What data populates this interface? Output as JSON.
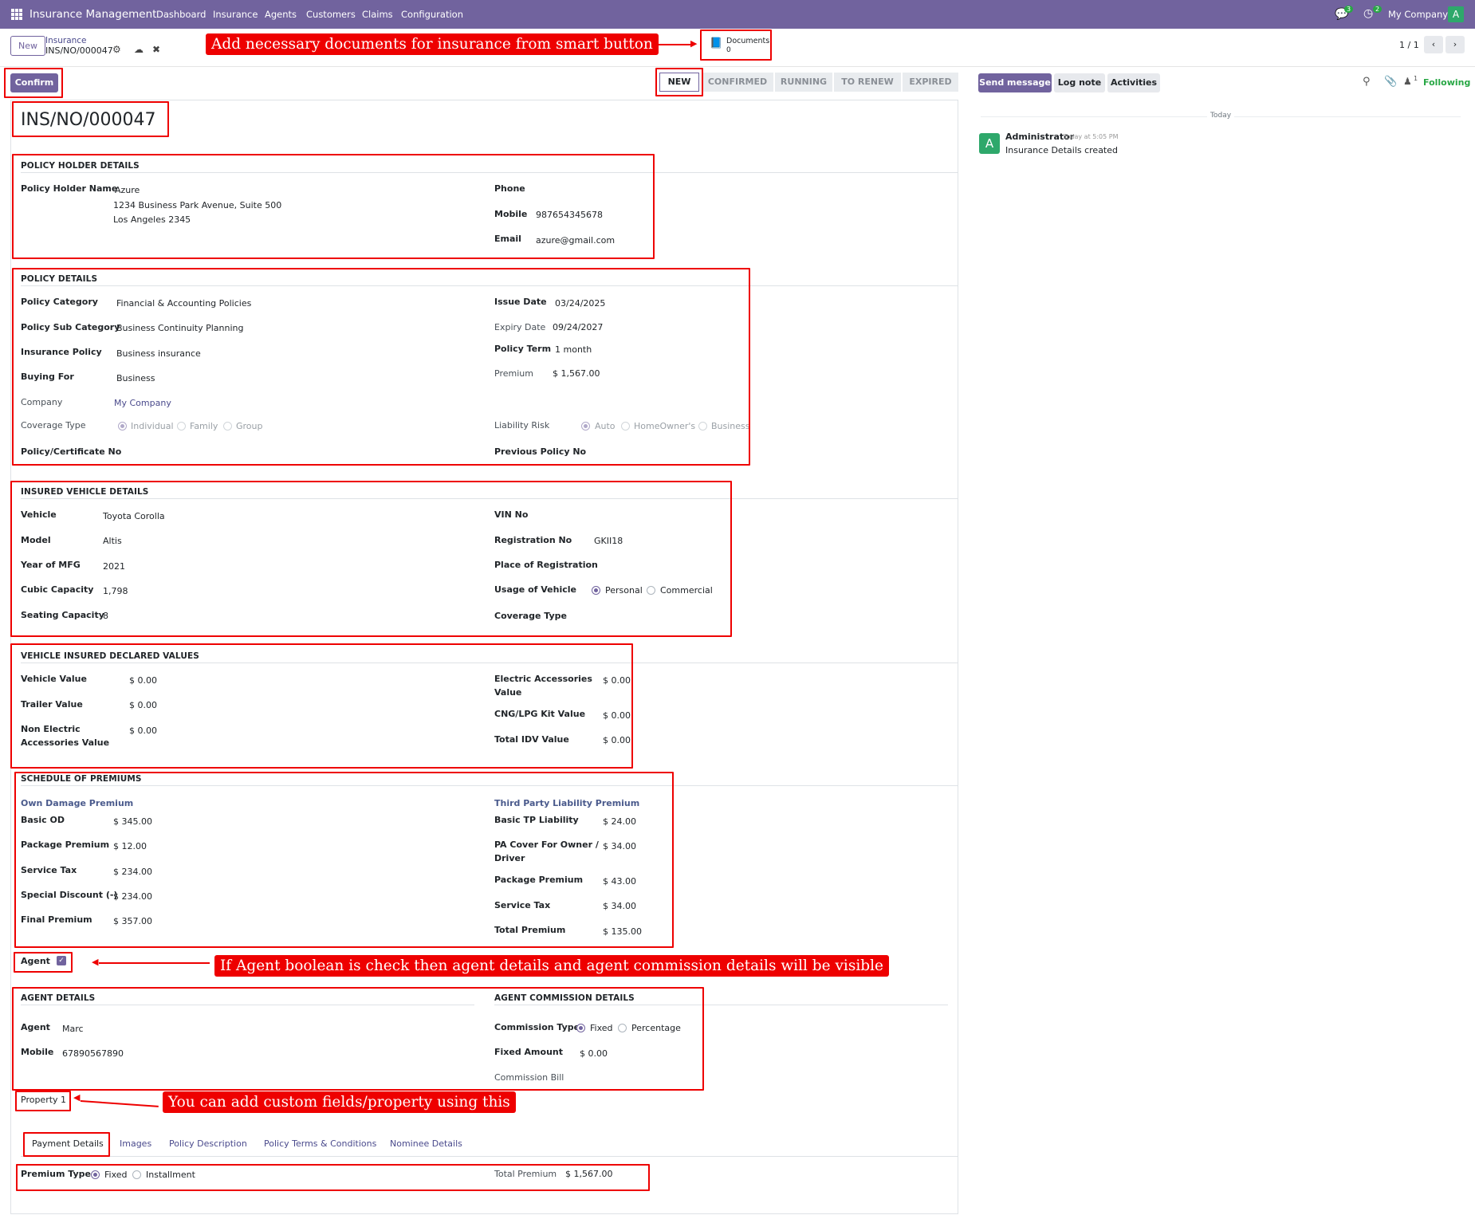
{
  "topnav": {
    "app_title": "Insurance Management",
    "menu": [
      "Dashboard",
      "Insurance",
      "Agents",
      "Customers",
      "Claims",
      "Configuration"
    ],
    "messages_count": "3",
    "activities_count": "2",
    "company": "My Company",
    "avatar_letter": "A",
    "accent": "#71639e"
  },
  "control": {
    "new_label": "New",
    "breadcrumb_parent": "Insurance",
    "breadcrumb_current": "INS/NO/000047",
    "documents_label": "Documents",
    "documents_count": "0",
    "pager": "1 / 1"
  },
  "callouts": {
    "documents": "Add necessary documents for insurance from smart button",
    "agent": "If Agent boolean is check then agent details and agent commission details will be visible",
    "property": "You can add custom fields/property using this"
  },
  "statusbar": {
    "confirm_label": "Confirm",
    "stages": [
      "NEW",
      "CONFIRMED",
      "RUNNING",
      "TO RENEW",
      "EXPIRED"
    ]
  },
  "chatter": {
    "send_message": "Send message",
    "log_note": "Log note",
    "activities": "Activities",
    "followers_count": "1",
    "following": "Following",
    "date_sep": "Today",
    "author": "Administrator",
    "time": "Today at 5:05 PM",
    "message": "Insurance Details created",
    "avatar_color": "#2ea86b"
  },
  "form": {
    "name": "INS/NO/000047",
    "holder": {
      "title": "POLICY HOLDER DETAILS",
      "name_label": "Policy Holder Name",
      "name_lines": [
        "Azure",
        "1234 Business Park Avenue, Suite 500",
        "Los Angeles 2345"
      ],
      "phone_label": "Phone",
      "mobile_label": "Mobile",
      "mobile": "987654345678",
      "email_label": "Email",
      "email": "azure@gmail.com"
    },
    "policy": {
      "title": "POLICY DETAILS",
      "category_label": "Policy Category",
      "category": "Financial & Accounting Policies",
      "subcategory_label": "Policy Sub Category",
      "subcategory": "Business Continuity Planning",
      "ins_policy_label": "Insurance Policy",
      "ins_policy": "Business insurance",
      "buying_label": "Buying For",
      "buying": "Business",
      "company_label": "Company",
      "company": "My Company",
      "coverage_label": "Coverage Type",
      "coverage_opts": [
        "Individual",
        "Family",
        "Group"
      ],
      "cert_label": "Policy/Certificate No",
      "issue_label": "Issue Date",
      "issue": "03/24/2025",
      "expiry_label": "Expiry Date",
      "expiry": "09/24/2027",
      "term_label": "Policy Term",
      "term": "1 month",
      "premium_label": "Premium",
      "premium": "$ 1,567.00",
      "liability_label": "Liability Risk",
      "liability_opts": [
        "Auto",
        "HomeOwner's",
        "Business"
      ],
      "prev_label": "Previous Policy No"
    },
    "vehicle": {
      "title": "INSURED VEHICLE DETAILS",
      "vehicle_label": "Vehicle",
      "vehicle": "Toyota Corolla",
      "model_label": "Model",
      "model": "Altis",
      "year_label": "Year of MFG",
      "year": "2021",
      "cc_label": "Cubic Capacity",
      "cc": "1,798",
      "seat_label": "Seating Capacity",
      "seat": "8",
      "vin_label": "VIN No",
      "reg_label": "Registration No",
      "reg": "GKII18",
      "place_label": "Place of Registration",
      "usage_label": "Usage of Vehicle",
      "usage_opts": [
        "Personal",
        "Commercial"
      ],
      "cov_label": "Coverage Type"
    },
    "declared": {
      "title": "VEHICLE INSURED DECLARED VALUES",
      "veh_label": "Vehicle Value",
      "veh": "$ 0.00",
      "trailer_label": "Trailer Value",
      "trailer": "$ 0.00",
      "nonelec_label_1": "Non Electric",
      "nonelec_label_2": "Accessories Value",
      "nonelec": "$ 0.00",
      "elec_label_1": "Electric Accessories",
      "elec_label_2": "Value",
      "elec": "$ 0.00",
      "cng_label": "CNG/LPG Kit Value",
      "cng": "$ 0.00",
      "idv_label": "Total IDV Value",
      "idv": "$ 0.00"
    },
    "premiums": {
      "title": "SCHEDULE OF PREMIUMS",
      "own_title": "Own Damage Premium",
      "own": [
        {
          "label": "Basic OD",
          "value": "$ 345.00"
        },
        {
          "label": "Package Premium",
          "value": "$ 12.00"
        },
        {
          "label": "Service Tax",
          "value": "$ 234.00"
        },
        {
          "label": "Special Discount (-)",
          "value": "$ 234.00"
        },
        {
          "label": "Final Premium",
          "value": "$ 357.00"
        }
      ],
      "tp_title": "Third Party Liability Premium",
      "tp_basic_label": "Basic TP Liability",
      "tp_basic": "$ 24.00",
      "tp_pa_label_1": "PA Cover For Owner /",
      "tp_pa_label_2": "Driver",
      "tp_pa": "$ 34.00",
      "tp_pkg_label": "Package Premium",
      "tp_pkg": "$ 43.00",
      "tp_tax_label": "Service Tax",
      "tp_tax": "$ 34.00",
      "tp_total_label": "Total Premium",
      "tp_total": "$ 135.00"
    },
    "agent_label": "Agent",
    "agent": {
      "title": "AGENT DETAILS",
      "agent_label": "Agent",
      "agent": "Marc",
      "mobile_label": "Mobile",
      "mobile": "67890567890",
      "comm_title": "AGENT COMMISSION DETAILS",
      "comm_type_label": "Commission Type",
      "comm_opts": [
        "Fixed",
        "Percentage"
      ],
      "fixed_label": "Fixed Amount",
      "fixed": "$ 0.00",
      "bill_label": "Commission Bill"
    },
    "property_label": "Property 1",
    "tabs": [
      "Payment Details",
      "Images",
      "Policy Description",
      "Policy Terms & Conditions",
      "Nominee Details"
    ],
    "payment": {
      "type_label": "Premium Type",
      "type_opts": [
        "Fixed",
        "Installment"
      ],
      "total_label": "Total Premium",
      "total": "$ 1,567.00"
    }
  }
}
